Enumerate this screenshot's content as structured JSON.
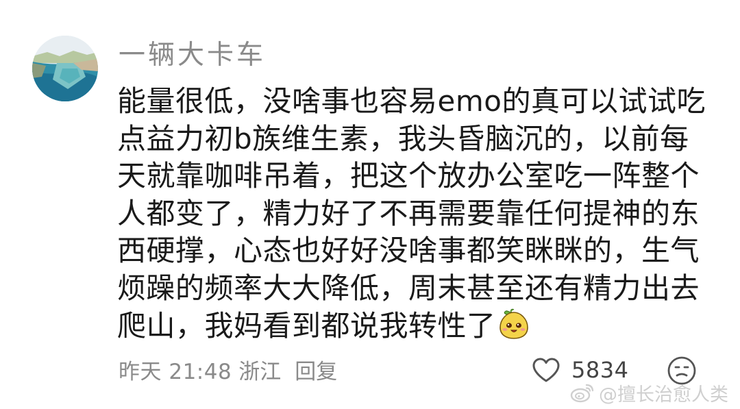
{
  "comment": {
    "username": "一辆大卡车",
    "lines": [
      "能量很低，没啥事也容易emo的真可以试试吃",
      "点益力初b族维生素，我头昏脑沉的，以前每",
      "天就靠咖啡吊着，把这个放办公室吃一阵整个",
      "人都变了，精力好了不再需要靠任何提神的东",
      "西硬撑，心态也好好没啥事都笑眯眯的，生气",
      "烦躁的频率大大降低，周末甚至还有精力出去",
      "爬山，我妈看到都说我转性了"
    ],
    "time": "昨天 21:48",
    "location": "浙江",
    "reply_label": "回复",
    "like_count": "5834"
  },
  "watermark": {
    "text": "@擅长治愈人类"
  },
  "icons": {
    "avatar": "avatar-beach-photo",
    "sticker": "cute-sticker-icon",
    "like": "heart-outline-icon",
    "reaction": "neutral-face-icon",
    "watermark_logo": "weibo-logo-icon"
  },
  "colors": {
    "text_primary": "#1a1a1a",
    "text_secondary": "#8a8a8a",
    "background": "#ffffff"
  }
}
